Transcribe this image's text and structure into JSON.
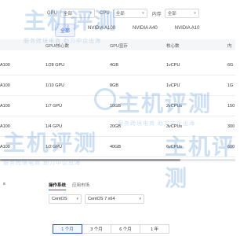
{
  "filters": [
    {
      "label": "GPU",
      "value": "全部"
    },
    {
      "label": "CPU",
      "value": "全部"
    },
    {
      "label": "内存",
      "value": "全部"
    }
  ],
  "gpu_tabs": [
    "全部",
    "NVIDIA A100",
    "NVIDIA A40",
    "NVIDIA A10"
  ],
  "gpu_tabs_active": 0,
  "table": {
    "headers": [
      "",
      "GPU/核心数",
      "GPU显存",
      "核心数",
      "内"
    ],
    "rows": [
      [
        "A100",
        "1/28 GPU",
        "4GB",
        "1vCPU",
        "6G"
      ],
      [
        "A100",
        "1/10 GPU",
        "8GB",
        "1vCPU",
        "1G"
      ],
      [
        "A100",
        "1/7 GPU",
        "10GB",
        "2vCPUs",
        "150"
      ],
      [
        "A100",
        "1/4 GPU",
        "20GB",
        "3vCPUs",
        "300"
      ],
      [
        "A100",
        "1/2 GPU",
        "40GB",
        "6vCPUs",
        "600"
      ]
    ]
  },
  "config": {
    "bullet": "s",
    "tabs": [
      "操作系统",
      "应用市场"
    ],
    "active_tab": 0,
    "os_name": "CentOS",
    "os_version": "CentOS 7 x64"
  },
  "durations": [
    "1 个月",
    "3 个月",
    "6 个月",
    "1 年"
  ],
  "durations_active": 0,
  "watermark": {
    "brand": "主机评测",
    "tagline": "服务跨境电商 助力中企出海"
  }
}
